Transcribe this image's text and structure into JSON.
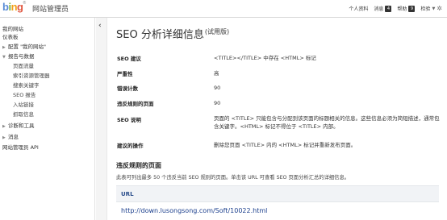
{
  "header": {
    "logo": {
      "b": "b",
      "i": "i",
      "n": "n",
      "g": "g",
      "reg": "®"
    },
    "app_title": "网站管理员",
    "nav": {
      "profile": "个人资料",
      "messages": "消息",
      "messages_count": "4",
      "help": "帮助",
      "help_count": "9",
      "settings": "检验",
      "caret": "▼"
    }
  },
  "sidebar": {
    "items": [
      {
        "label": "我的网站",
        "arrow": ""
      },
      {
        "label": "仪表板",
        "arrow": ""
      },
      {
        "label": "配置 \"我的网站\"",
        "arrow": "▶"
      },
      {
        "label": "报告与数据",
        "arrow": "▼"
      },
      {
        "label": "页面流量",
        "arrow": ""
      },
      {
        "label": "索引资源管理器",
        "arrow": ""
      },
      {
        "label": "搜索关键字",
        "arrow": ""
      },
      {
        "label": "SEO 报告",
        "arrow": ""
      },
      {
        "label": "入站链接",
        "arrow": ""
      },
      {
        "label": "抓取信息",
        "arrow": ""
      },
      {
        "label": "诊断和工具",
        "arrow": "▶"
      },
      {
        "label": "消息",
        "arrow": "▶"
      },
      {
        "label": "网站管理员 API",
        "arrow": ""
      }
    ]
  },
  "collapse_glyph": "‹",
  "main": {
    "title": "SEO 分析详细信息",
    "title_suffix": "(试用版)",
    "rows": [
      {
        "label": "SEO 建议",
        "value": "<TITLE></TITLE> 中存在 <HTML> 标记"
      },
      {
        "label": "严重性",
        "value": "高"
      },
      {
        "label": "错误计数",
        "value": "90"
      },
      {
        "label": "违反规则的页面",
        "value": "90"
      },
      {
        "label": "SEO 说明",
        "value": "页面的 <TITLE> 只能包含与分配到该页面的标题相关的信息。这些信息必须为简短描述，通常包含关键字。<HTML> 标记不得位于 <TITLE> 内部。"
      },
      {
        "label": "建议的操作",
        "value": "删除您页面 <TITLE> 内的 <HTML> 标记并重新发布页面。"
      }
    ],
    "section_title": "违反规则的页面",
    "section_desc": "此表可列出最多 50 个违反当前 SEO 规则的页面。单击该 URL 可查看 SEO 页面分析汇总的详细信息。",
    "url_header": "URL",
    "urls": [
      "http://down.lusongsong.com/Soft/10022.html"
    ]
  }
}
